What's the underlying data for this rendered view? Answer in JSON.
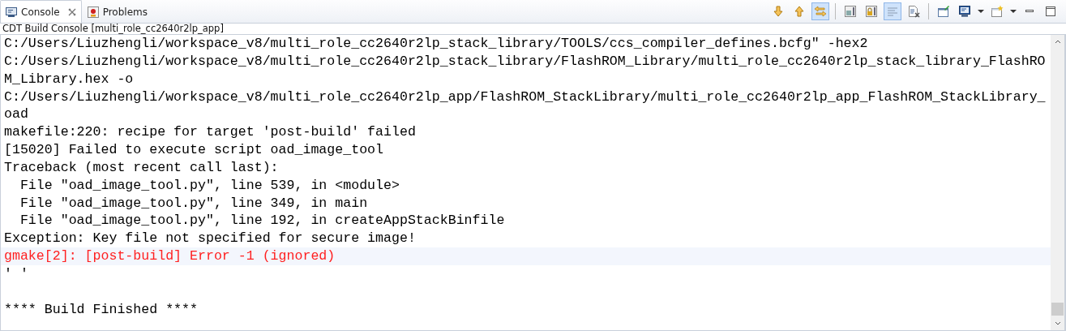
{
  "tabs": [
    {
      "label": "Console",
      "kind": "console",
      "selected": true,
      "closable": true
    },
    {
      "label": "Problems",
      "kind": "problems",
      "selected": false,
      "closable": false
    }
  ],
  "toolbar": [
    {
      "kind": "arrow-down",
      "selected": false
    },
    {
      "kind": "arrow-up",
      "selected": false
    },
    {
      "kind": "swap",
      "selected": true
    },
    {
      "kind": "sep"
    },
    {
      "kind": "save-doc",
      "selected": false
    },
    {
      "kind": "lock-doc",
      "selected": false
    },
    {
      "kind": "lines",
      "selected": true
    },
    {
      "kind": "clear-doc",
      "selected": false
    },
    {
      "kind": "sep"
    },
    {
      "kind": "pin",
      "selected": false
    },
    {
      "kind": "monitor",
      "selected": false
    },
    {
      "kind": "caret",
      "selected": false
    },
    {
      "kind": "new-window",
      "selected": false
    },
    {
      "kind": "caret",
      "selected": false
    },
    {
      "kind": "minimize",
      "selected": false
    },
    {
      "kind": "maximize",
      "selected": false
    }
  ],
  "console_title": "CDT Build Console [multi_role_cc2640r2lp_app]",
  "lines": [
    {
      "text": "C:/Users/Liuzhengli/workspace_v8/multi_role_cc2640r2lp_stack_library/TOOLS/ccs_compiler_defines.bcfg\" -hex2",
      "kind": "normal",
      "highlighted": false
    },
    {
      "text": "C:/Users/Liuzhengli/workspace_v8/multi_role_cc2640r2lp_stack_library/FlashROM_Library/multi_role_cc2640r2lp_stack_library_FlashRO",
      "kind": "normal",
      "highlighted": false
    },
    {
      "text": "M_Library.hex -o",
      "kind": "normal",
      "highlighted": false
    },
    {
      "text": "C:/Users/Liuzhengli/workspace_v8/multi_role_cc2640r2lp_app/FlashROM_StackLibrary/multi_role_cc2640r2lp_app_FlashROM_StackLibrary_",
      "kind": "normal",
      "highlighted": false
    },
    {
      "text": "oad",
      "kind": "normal",
      "highlighted": false
    },
    {
      "text": "makefile:220: recipe for target 'post-build' failed",
      "kind": "normal",
      "highlighted": false
    },
    {
      "text": "[15020] Failed to execute script oad_image_tool",
      "kind": "normal",
      "highlighted": false
    },
    {
      "text": "Traceback (most recent call last):",
      "kind": "normal",
      "highlighted": false
    },
    {
      "text": "  File \"oad_image_tool.py\", line 539, in <module>",
      "kind": "normal",
      "highlighted": false
    },
    {
      "text": "  File \"oad_image_tool.py\", line 349, in main",
      "kind": "normal",
      "highlighted": false
    },
    {
      "text": "  File \"oad_image_tool.py\", line 192, in createAppStackBinfile",
      "kind": "normal",
      "highlighted": false
    },
    {
      "text": "Exception: Key file not specified for secure image!",
      "kind": "normal",
      "highlighted": false
    },
    {
      "text": "gmake[2]: [post-build] Error -1 (ignored)",
      "kind": "error",
      "highlighted": true
    },
    {
      "text": "' '",
      "kind": "normal",
      "highlighted": false
    },
    {
      "kind": "blank",
      "highlighted": false
    },
    {
      "text": "**** Build Finished ****",
      "kind": "normal",
      "highlighted": false
    }
  ]
}
